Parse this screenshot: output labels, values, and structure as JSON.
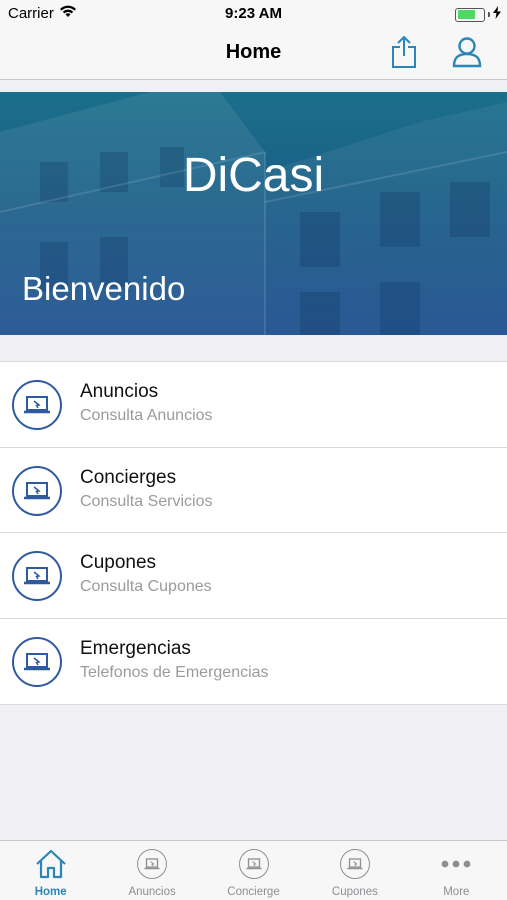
{
  "status_bar": {
    "carrier": "Carrier",
    "time": "9:23 AM"
  },
  "nav": {
    "title": "Home",
    "share_icon": "share-icon",
    "profile_icon": "person-icon"
  },
  "hero": {
    "title": "DiCasi",
    "subtitle": "Bienvenido"
  },
  "menu": {
    "items": [
      {
        "title": "Anuncios",
        "subtitle": "Consulta Anuncios",
        "icon": "laptop-icon"
      },
      {
        "title": "Concierges",
        "subtitle": "Consulta Servicios",
        "icon": "laptop-icon"
      },
      {
        "title": "Cupones",
        "subtitle": "Consulta Cupones",
        "icon": "laptop-icon"
      },
      {
        "title": "Emergencias",
        "subtitle": "Telefonos de Emergencias",
        "icon": "laptop-icon"
      }
    ]
  },
  "tabs": [
    {
      "label": "Home",
      "icon": "home-icon",
      "active": true
    },
    {
      "label": "Anuncios",
      "icon": "laptop-icon",
      "active": false
    },
    {
      "label": "Concierge",
      "icon": "laptop-icon",
      "active": false
    },
    {
      "label": "Cupones",
      "icon": "laptop-icon",
      "active": false
    },
    {
      "label": "More",
      "icon": "more-icon",
      "active": false
    }
  ],
  "colors": {
    "accent": "#2b86b8",
    "icon_blue": "#2f5aa0",
    "hero_top": "#1b6f8a",
    "hero_bottom": "#1d4e8e",
    "battery": "#4cd964"
  }
}
